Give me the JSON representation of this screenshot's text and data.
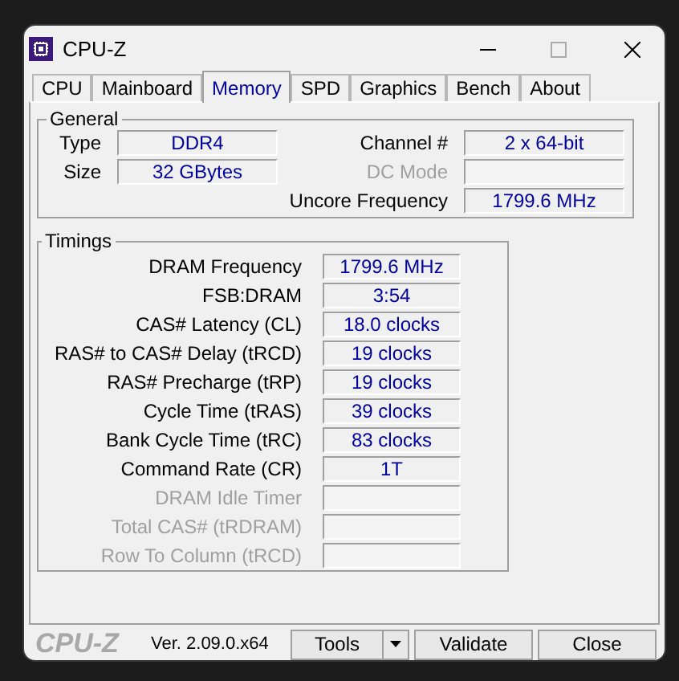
{
  "window": {
    "title": "CPU-Z"
  },
  "tabs": [
    {
      "label": "CPU",
      "selected": false
    },
    {
      "label": "Mainboard",
      "selected": false
    },
    {
      "label": "Memory",
      "selected": true
    },
    {
      "label": "SPD",
      "selected": false
    },
    {
      "label": "Graphics",
      "selected": false
    },
    {
      "label": "Bench",
      "selected": false
    },
    {
      "label": "About",
      "selected": false
    }
  ],
  "general": {
    "title": "General",
    "left": [
      {
        "label": "Type",
        "value": "DDR4",
        "disabled": false
      },
      {
        "label": "Size",
        "value": "32 GBytes",
        "disabled": false
      }
    ],
    "right": [
      {
        "label": "Channel #",
        "value": "2 x 64-bit",
        "disabled": false
      },
      {
        "label": "DC Mode",
        "disabled": true
      },
      {
        "label": "Uncore Frequency",
        "value": "1799.6 MHz",
        "disabled": false
      }
    ]
  },
  "timings": {
    "title": "Timings",
    "rows": [
      {
        "label": "DRAM Frequency",
        "value": "1799.6 MHz",
        "disabled": false
      },
      {
        "label": "FSB:DRAM",
        "value": "3:54",
        "disabled": false
      },
      {
        "label": "CAS# Latency (CL)",
        "value": "18.0 clocks",
        "disabled": false
      },
      {
        "label": "RAS# to CAS# Delay (tRCD)",
        "value": "19 clocks",
        "disabled": false
      },
      {
        "label": "RAS# Precharge (tRP)",
        "value": "19 clocks",
        "disabled": false
      },
      {
        "label": "Cycle Time (tRAS)",
        "value": "39 clocks",
        "disabled": false
      },
      {
        "label": "Bank Cycle Time (tRC)",
        "value": "83 clocks",
        "disabled": false
      },
      {
        "label": "Command Rate (CR)",
        "value": "1T",
        "disabled": false
      },
      {
        "label": "DRAM Idle Timer",
        "disabled": true
      },
      {
        "label": "Total CAS# (tRDRAM)",
        "disabled": true
      },
      {
        "label": "Row To Column (tRCD)",
        "disabled": true
      }
    ]
  },
  "footer": {
    "logo": "CPU-Z",
    "version": "Ver. 2.09.0.x64",
    "buttons": [
      {
        "label": "Tools",
        "kind": "dropdown"
      },
      {
        "label": "Validate",
        "kind": "plain"
      },
      {
        "label": "Close",
        "kind": "plain"
      }
    ]
  }
}
